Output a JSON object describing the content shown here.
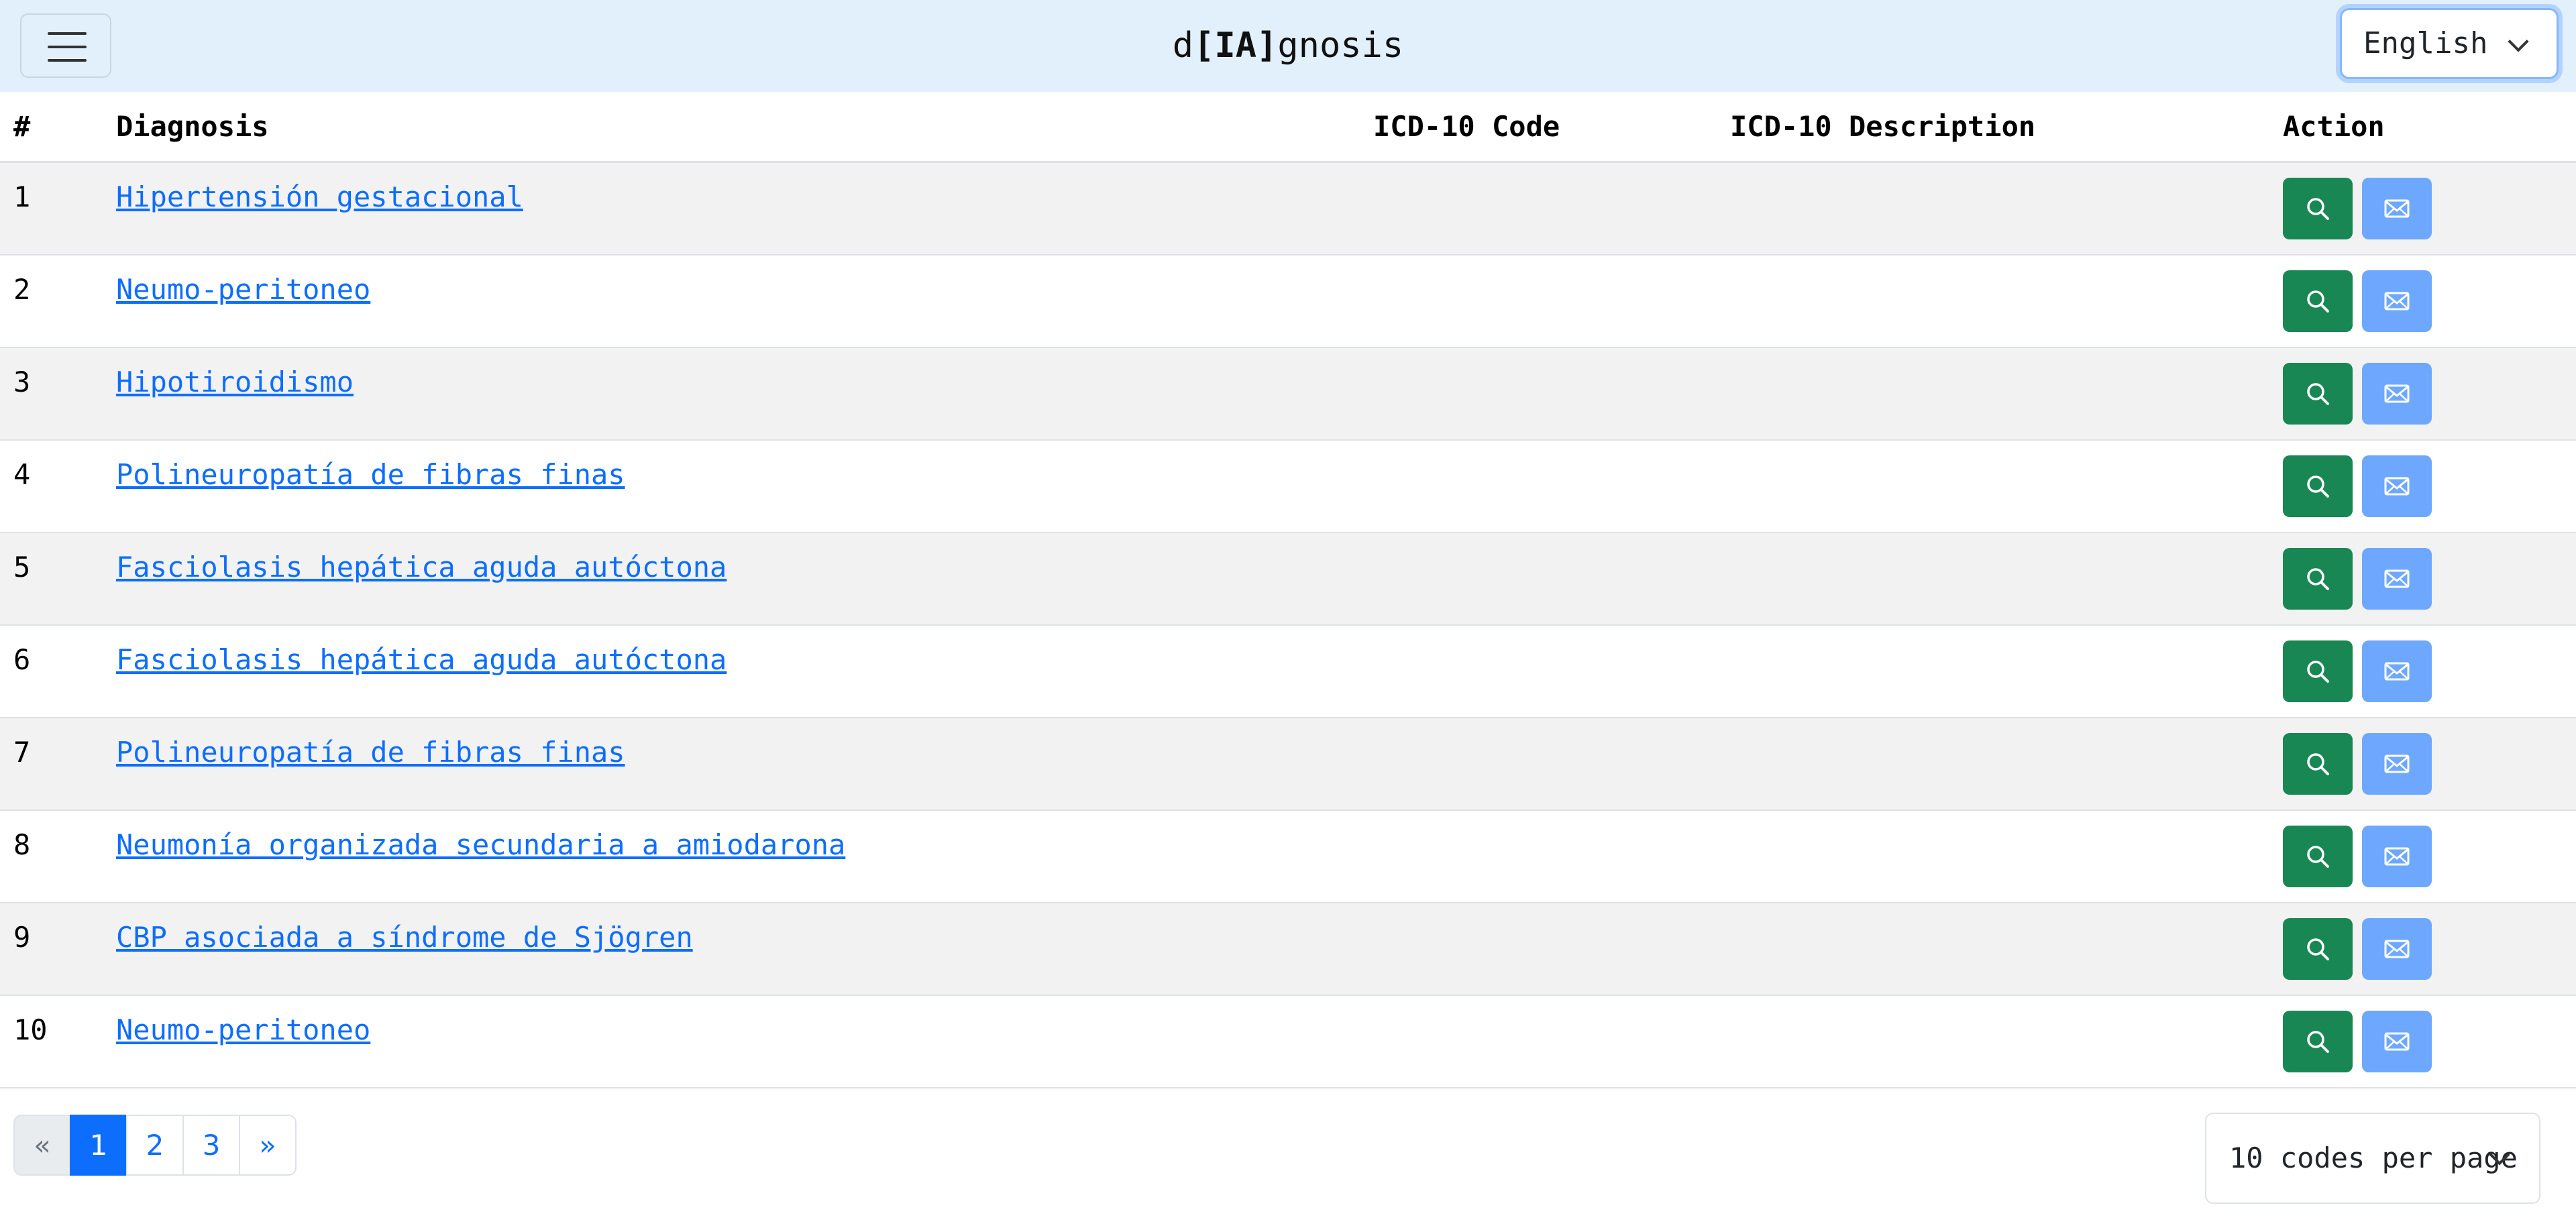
{
  "navbar": {
    "brand_prefix": "d",
    "brand_bracket_open": "[",
    "brand_bold": "IA",
    "brand_bracket_close": "]",
    "brand_suffix": "gnosis",
    "language": "English"
  },
  "table": {
    "headers": {
      "num": "#",
      "diagnosis": "Diagnosis",
      "icd_code": "ICD-10 Code",
      "icd_description": "ICD-10 Description",
      "action": "Action"
    },
    "rows": [
      {
        "num": "1",
        "diagnosis": "Hipertensión gestacional",
        "icd_code": "",
        "icd_description": ""
      },
      {
        "num": "2",
        "diagnosis": "Neumo-peritoneo",
        "icd_code": "",
        "icd_description": ""
      },
      {
        "num": "3",
        "diagnosis": "Hipotiroidismo",
        "icd_code": "",
        "icd_description": ""
      },
      {
        "num": "4",
        "diagnosis": "Polineuropatía de fibras finas",
        "icd_code": "",
        "icd_description": ""
      },
      {
        "num": "5",
        "diagnosis": "Fasciolasis hepática aguda autóctona",
        "icd_code": "",
        "icd_description": ""
      },
      {
        "num": "6",
        "diagnosis": "Fasciolasis hepática aguda autóctona",
        "icd_code": "",
        "icd_description": ""
      },
      {
        "num": "7",
        "diagnosis": "Polineuropatía de fibras finas",
        "icd_code": "",
        "icd_description": ""
      },
      {
        "num": "8",
        "diagnosis": "Neumonía organizada secundaria a amiodarona",
        "icd_code": "",
        "icd_description": ""
      },
      {
        "num": "9",
        "diagnosis": "CBP asociada a síndrome de Sjögren",
        "icd_code": "",
        "icd_description": ""
      },
      {
        "num": "10",
        "diagnosis": "Neumo-peritoneo",
        "icd_code": "",
        "icd_description": ""
      }
    ],
    "action_icons": {
      "search": "search-icon",
      "mail": "envelope-icon"
    }
  },
  "pagination": {
    "prev": "«",
    "pages": [
      "1",
      "2",
      "3"
    ],
    "active_page": "1",
    "next": "»"
  },
  "per_page": {
    "selected": "10 codes per page"
  },
  "colors": {
    "navbar_bg": "#e2f0fb",
    "link": "#0d6efd",
    "search_button": "#198754",
    "mail_button": "#6ea8fe",
    "row_stripe": "#f2f2f2"
  }
}
